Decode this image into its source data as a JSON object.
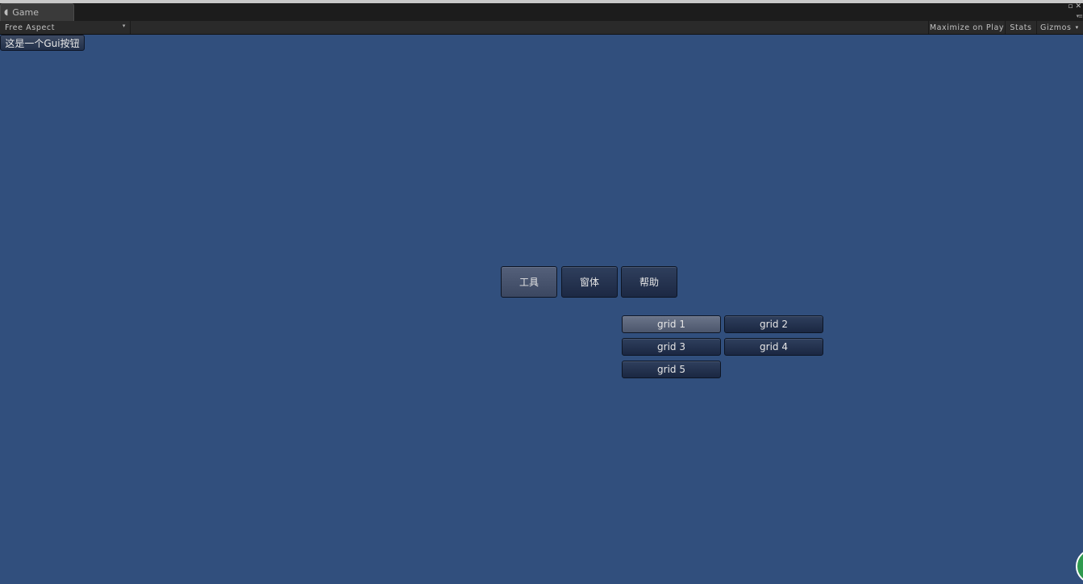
{
  "window": {
    "tab_label": "Game",
    "tab_icon": "pacman-icon"
  },
  "toolbar": {
    "aspect_label": "Free Aspect",
    "maximize_label": "Maximize on Play",
    "stats_label": "Stats",
    "gizmos_label": "Gizmos"
  },
  "game": {
    "background_color": "#314f7d",
    "gui_button_label": "这是一个Gui按钮",
    "toolbar_items": [
      {
        "label": "工具",
        "selected": true
      },
      {
        "label": "窗体",
        "selected": false
      },
      {
        "label": "帮助",
        "selected": false
      }
    ],
    "grid_items": [
      {
        "label": "grid 1",
        "selected": true
      },
      {
        "label": "grid 2",
        "selected": false
      },
      {
        "label": "grid 3",
        "selected": false
      },
      {
        "label": "grid 4",
        "selected": false
      },
      {
        "label": "grid 5",
        "selected": false
      }
    ]
  }
}
